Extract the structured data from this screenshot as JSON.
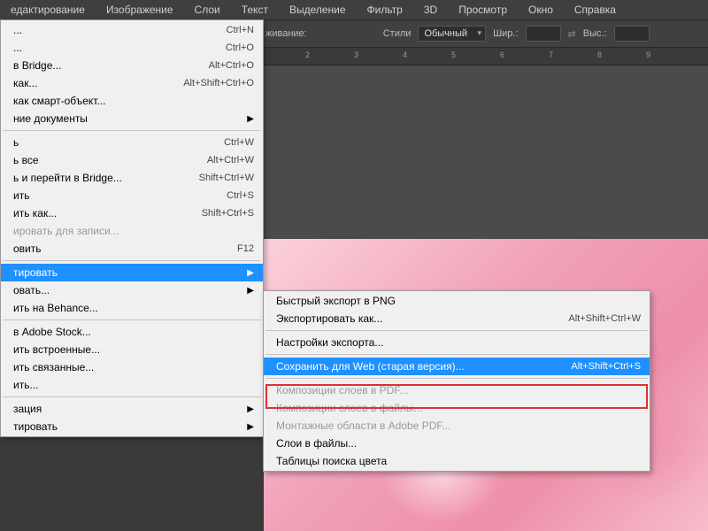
{
  "menubar": {
    "items": [
      "едактирование",
      "Изображение",
      "Слои",
      "Текст",
      "Выделение",
      "Фильтр",
      "3D",
      "Просмотр",
      "Окно",
      "Справка"
    ]
  },
  "toolbar": {
    "smoothing_label": "живание:",
    "styles_label": "Стили",
    "style_value": "Обычный",
    "width_label": "Шир.:",
    "height_label": "Выс.:"
  },
  "ruler": {
    "ticks": [
      "2",
      "3",
      "4",
      "5",
      "6",
      "7",
      "8",
      "9"
    ]
  },
  "file_menu": {
    "items": [
      {
        "label": "...",
        "shortcut": "Ctrl+N"
      },
      {
        "label": "...",
        "shortcut": "Ctrl+O"
      },
      {
        "label": "в Bridge...",
        "shortcut": "Alt+Ctrl+O"
      },
      {
        "label": "как...",
        "shortcut": "Alt+Shift+Ctrl+O"
      },
      {
        "label": "как смарт-объект..."
      },
      {
        "label": "ние документы",
        "arrow": true
      }
    ],
    "items2": [
      {
        "label": "ь",
        "shortcut": "Ctrl+W"
      },
      {
        "label": "ь все",
        "shortcut": "Alt+Ctrl+W"
      },
      {
        "label": "ь и перейти в Bridge...",
        "shortcut": "Shift+Ctrl+W"
      },
      {
        "label": "ить",
        "shortcut": "Ctrl+S"
      },
      {
        "label": "ить как...",
        "shortcut": "Shift+Ctrl+S"
      },
      {
        "label": "ировать для записи...",
        "disabled": true
      },
      {
        "label": "овить",
        "shortcut": "F12"
      }
    ],
    "items3": [
      {
        "label": "тировать",
        "highlight": true,
        "arrow": true
      }
    ],
    "items4": [
      {
        "label": "овать...",
        "arrow": true
      },
      {
        "label": "ить на Behance..."
      }
    ],
    "items5": [
      {
        "label": "в Adobe Stock..."
      },
      {
        "label": "ить встроенные..."
      },
      {
        "label": "ить связанные..."
      },
      {
        "label": "ить..."
      }
    ],
    "items6": [
      {
        "label": "зация",
        "arrow": true
      },
      {
        "label": "тировать",
        "arrow": true
      }
    ]
  },
  "export_submenu": {
    "items1": [
      {
        "label": "Быстрый экспорт в PNG"
      },
      {
        "label": "Экспортировать как...",
        "shortcut": "Alt+Shift+Ctrl+W"
      }
    ],
    "items2": [
      {
        "label": "Настройки экспорта..."
      }
    ],
    "items3": [
      {
        "label": "Сохранить для Web (старая версия)...",
        "shortcut": "Alt+Shift+Ctrl+S",
        "highlight": true,
        "boxed": true
      }
    ],
    "items4": [
      {
        "label": "Композиции слоев в PDF...",
        "disabled": true
      },
      {
        "label": "Композиции слоев в файлы...",
        "disabled": true
      },
      {
        "label": "Монтажные области в Adobe PDF...",
        "disabled": true
      },
      {
        "label": "Слои в файлы..."
      },
      {
        "label": "Таблицы поиска цвета"
      }
    ]
  }
}
